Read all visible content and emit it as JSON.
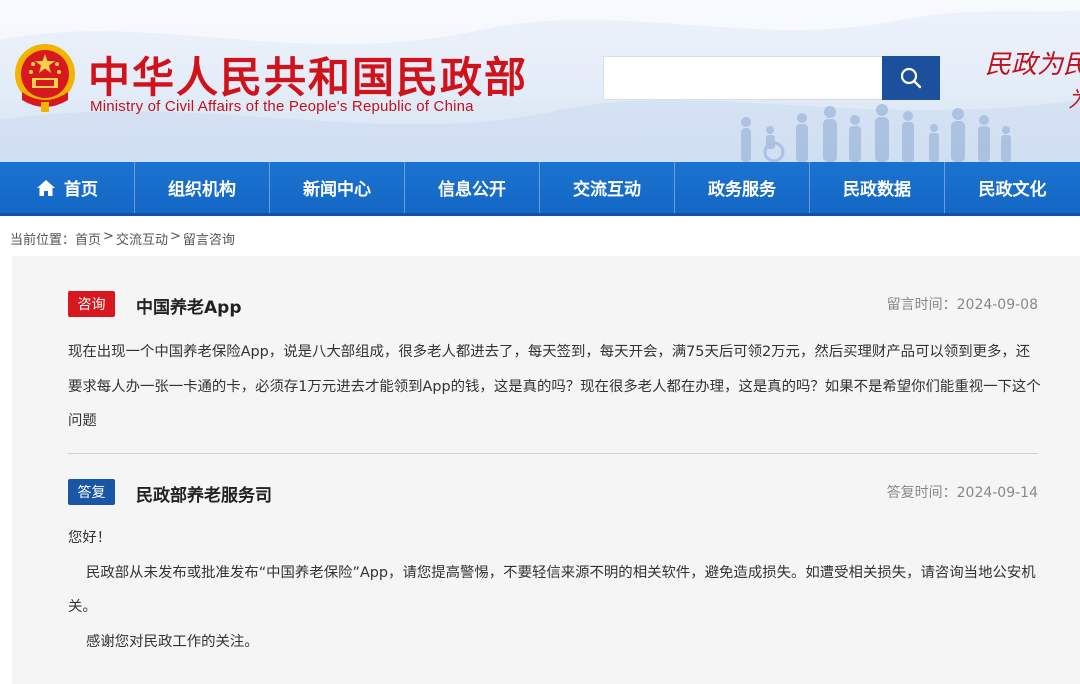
{
  "header": {
    "site_title": "中华人民共和国民政部",
    "site_subtitle": "Ministry of Civil Affairs of the People's Republic of China",
    "search_placeholder": "",
    "slogan_line1": "民政为民",
    "slogan_line2": "为"
  },
  "nav": {
    "items": [
      {
        "label": "首页",
        "icon": "home-icon"
      },
      {
        "label": "组织机构"
      },
      {
        "label": "新闻中心"
      },
      {
        "label": "信息公开"
      },
      {
        "label": "交流互动"
      },
      {
        "label": "政务服务"
      },
      {
        "label": "民政数据"
      },
      {
        "label": "民政文化"
      }
    ]
  },
  "breadcrumb": {
    "prefix": "当前位置：",
    "items": [
      "首页",
      "交流互动",
      "留言咨询"
    ],
    "separator": ">"
  },
  "inquiry": {
    "tag": "咨询",
    "title": "中国养老App",
    "meta": "留言时间：2024-09-08",
    "body": "现在出现一个中国养老保险App，说是八大部组成，很多老人都进去了，每天签到，每天开会，满75天后可领2万元，然后买理财产品可以领到更多，还要求每人办一张一卡通的卡，必须存1万元进去才能领到App的钱，这是真的吗？现在很多老人都在办理，这是真的吗？如果不是希望你们能重视一下这个问题"
  },
  "reply": {
    "tag": "答复",
    "title": "民政部养老服务司",
    "meta": "答复时间：2024-09-14",
    "greeting": "您好！",
    "paragraph1": "民政部从未发布或批准发布“中国养老保险”App，请您提高警惕，不要轻信来源不明的相关软件，避免造成损失。如遭受相关损失，请咨询当地公安机关。",
    "paragraph2": "感谢您对民政工作的关注。"
  },
  "colors": {
    "nav_blue": "#1467c4",
    "brand_red": "#d0121b",
    "reply_tag_blue": "#1a56a6",
    "search_button": "#1c4f9c"
  }
}
